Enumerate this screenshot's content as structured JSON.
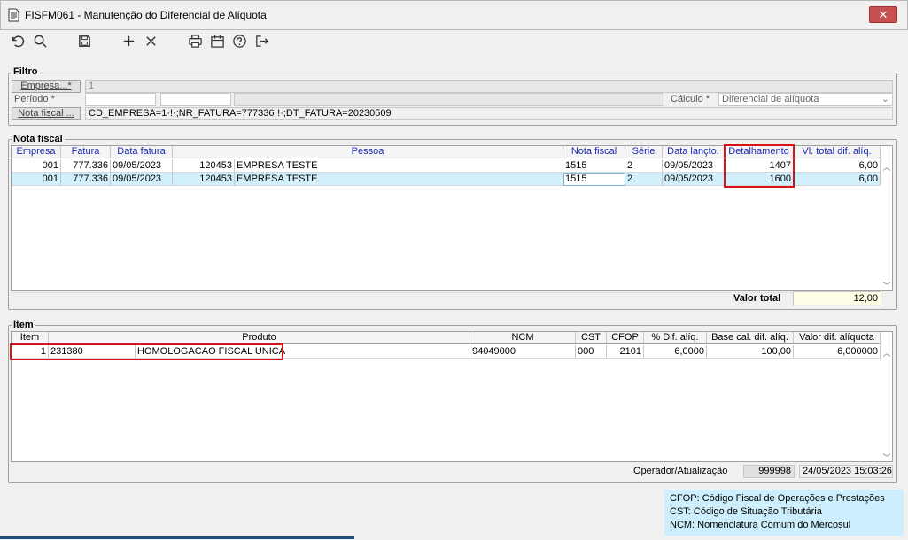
{
  "window": {
    "title": "FISFM061 - Manutenção do Diferencial de Alíquota",
    "close_label": "✕"
  },
  "toolbar": {
    "icons": [
      "undo-icon",
      "search-icon",
      "save-icon",
      "add-icon",
      "delete-icon",
      "print-icon",
      "calendar-icon",
      "help-icon",
      "exit-icon"
    ]
  },
  "filtro": {
    "title": "Filtro",
    "empresa_button": "Empresa...*",
    "empresa_value": "1",
    "periodo_label": "Período *",
    "periodo_start": "",
    "periodo_end": "",
    "calculo_label": "Cálculo *",
    "calculo_value": "Diferencial de alíquota",
    "nota_button": "Nota fiscal ...",
    "nota_value": "CD_EMPRESA=1·!·;NR_FATURA=777336·!·;DT_FATURA=20230509"
  },
  "nota_fiscal": {
    "title": "Nota fiscal",
    "columns": [
      "Empresa",
      "Fatura",
      "Data fatura",
      "Pessoa",
      "Nota fiscal",
      "Série",
      "Data lançto.",
      "Detalhamento",
      "Vl. total dif. alíq."
    ],
    "rows": [
      {
        "empresa": "001",
        "fatura": "777.336",
        "data_fatura": "09/05/2023",
        "pessoa_cod": "120453",
        "pessoa_nome": "EMPRESA TESTE",
        "nota": "1515",
        "serie": "2",
        "data_lanc": "09/05/2023",
        "detalhamento": "1407",
        "vl_total": "6,00"
      },
      {
        "empresa": "001",
        "fatura": "777.336",
        "data_fatura": "09/05/2023",
        "pessoa_cod": "120453",
        "pessoa_nome": "EMPRESA TESTE",
        "nota": "1515",
        "serie": "2",
        "data_lanc": "09/05/2023",
        "detalhamento": "1600",
        "vl_total": "6,00"
      }
    ],
    "valor_total_label": "Valor total",
    "valor_total": "12,00"
  },
  "item": {
    "title": "Item",
    "columns": [
      "Item",
      "Produto",
      "NCM",
      "CST",
      "CFOP",
      "% Dif. alíq.",
      "Base cal. dif. alíq.",
      "Valor dif. alíquota"
    ],
    "rows": [
      {
        "item": "1",
        "produto_cod": "231380",
        "produto_nome": "HOMOLOGACAO FISCAL UNICA",
        "ncm": "94049000",
        "cst": "000",
        "cfop": "2101",
        "perc": "6,0000",
        "base": "100,00",
        "valor": "6,000000"
      }
    ]
  },
  "footer": {
    "operador_label": "Operador/Atualização",
    "operador_value": "999998",
    "atualizacao_value": "24/05/2023 15:03:26"
  },
  "legend": [
    "CFOP: Código Fiscal de Operações e Prestações",
    "CST: Código de Situação Tributária",
    "NCM: Nomenclatura Comum do Mercosul"
  ],
  "colors": {
    "header_text": "#1a2cb0",
    "selected_row": "#d2f0fc",
    "highlight_border": "#d7141a",
    "legend_bg": "#cdeefc",
    "total_bg": "#fffde6"
  }
}
